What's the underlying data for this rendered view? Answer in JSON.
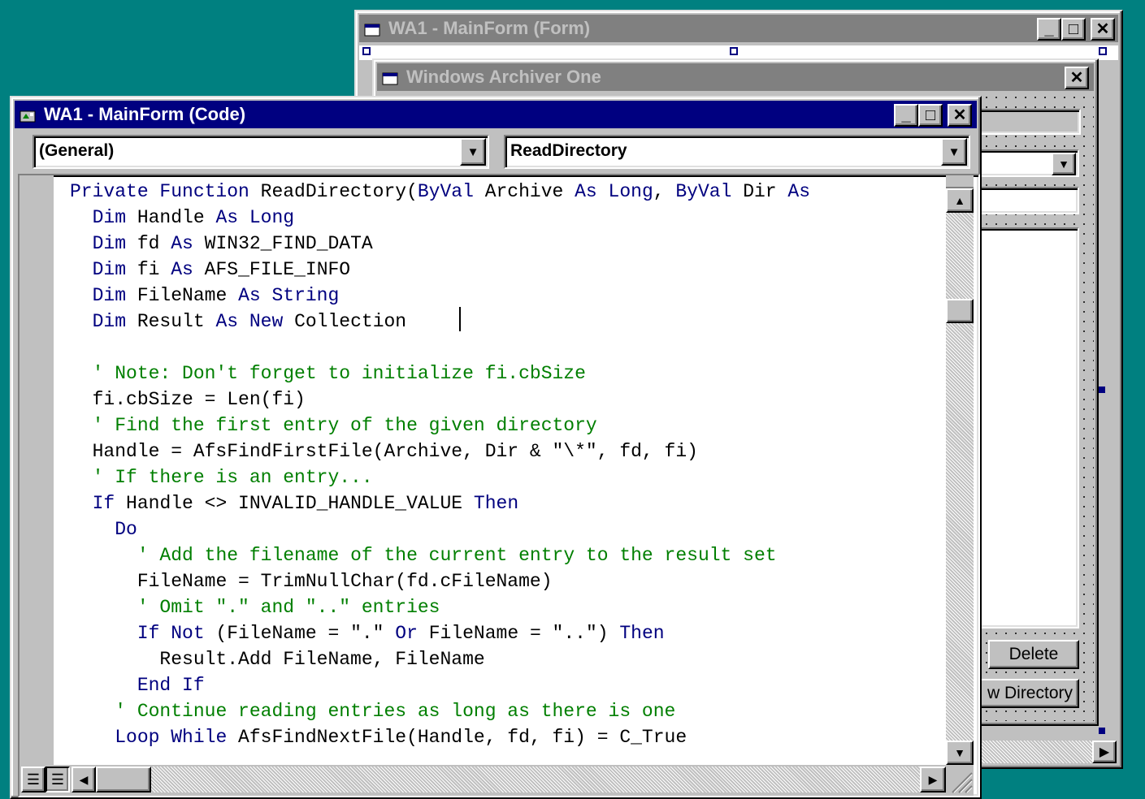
{
  "form_window": {
    "title": "WA1 - MainForm (Form)",
    "min": "_",
    "max": "□",
    "close": "✕"
  },
  "archiver_window": {
    "title": "Windows Archiver One",
    "close": "✕",
    "delete_label": "Delete",
    "new_dir_label": "w Directory"
  },
  "code_window": {
    "title": "WA1 - MainForm (Code)",
    "min": "_",
    "max": "□",
    "close": "✕",
    "object_combo": "(General)",
    "proc_combo": "ReadDirectory"
  },
  "code_lines": [
    {
      "indent": "",
      "parts": [
        [
          "kw",
          "Private Function "
        ],
        [
          "tx",
          "ReadDirectory("
        ],
        [
          "kw",
          "ByVal "
        ],
        [
          "tx",
          "Archive "
        ],
        [
          "kw",
          "As Long"
        ],
        [
          "tx",
          ", "
        ],
        [
          "kw",
          "ByVal "
        ],
        [
          "tx",
          "Dir "
        ],
        [
          "kw",
          "As "
        ]
      ]
    },
    {
      "indent": "  ",
      "parts": [
        [
          "kw",
          "Dim "
        ],
        [
          "tx",
          "Handle "
        ],
        [
          "kw",
          "As Long"
        ]
      ]
    },
    {
      "indent": "  ",
      "parts": [
        [
          "kw",
          "Dim "
        ],
        [
          "tx",
          "fd "
        ],
        [
          "kw",
          "As "
        ],
        [
          "tx",
          "WIN32_FIND_DATA"
        ]
      ]
    },
    {
      "indent": "  ",
      "parts": [
        [
          "kw",
          "Dim "
        ],
        [
          "tx",
          "fi "
        ],
        [
          "kw",
          "As "
        ],
        [
          "tx",
          "AFS_FILE_INFO"
        ]
      ]
    },
    {
      "indent": "  ",
      "parts": [
        [
          "kw",
          "Dim "
        ],
        [
          "tx",
          "FileName "
        ],
        [
          "kw",
          "As String"
        ]
      ]
    },
    {
      "indent": "  ",
      "parts": [
        [
          "kw",
          "Dim "
        ],
        [
          "tx",
          "Result "
        ],
        [
          "kw",
          "As New "
        ],
        [
          "tx",
          "Collection"
        ]
      ]
    },
    {
      "indent": "",
      "parts": []
    },
    {
      "indent": "  ",
      "parts": [
        [
          "cm",
          "' Note: Don't forget to initialize fi.cbSize"
        ]
      ]
    },
    {
      "indent": "  ",
      "parts": [
        [
          "tx",
          "fi.cbSize = Len(fi)"
        ]
      ]
    },
    {
      "indent": "  ",
      "parts": [
        [
          "cm",
          "' Find the first entry of the given directory"
        ]
      ]
    },
    {
      "indent": "  ",
      "parts": [
        [
          "tx",
          "Handle = AfsFindFirstFile(Archive, Dir & \"\\*\", fd, fi)"
        ]
      ]
    },
    {
      "indent": "  ",
      "parts": [
        [
          "cm",
          "' If there is an entry..."
        ]
      ]
    },
    {
      "indent": "  ",
      "parts": [
        [
          "kw",
          "If "
        ],
        [
          "tx",
          "Handle <> INVALID_HANDLE_VALUE "
        ],
        [
          "kw",
          "Then"
        ]
      ]
    },
    {
      "indent": "    ",
      "parts": [
        [
          "kw",
          "Do"
        ]
      ]
    },
    {
      "indent": "      ",
      "parts": [
        [
          "cm",
          "' Add the filename of the current entry to the result set"
        ]
      ]
    },
    {
      "indent": "      ",
      "parts": [
        [
          "tx",
          "FileName = TrimNullChar(fd.cFileName)"
        ]
      ]
    },
    {
      "indent": "      ",
      "parts": [
        [
          "cm",
          "' Omit \".\" and \"..\" entries"
        ]
      ]
    },
    {
      "indent": "      ",
      "parts": [
        [
          "kw",
          "If Not "
        ],
        [
          "tx",
          "(FileName = \".\" "
        ],
        [
          "kw",
          "Or "
        ],
        [
          "tx",
          "FileName = \"..\") "
        ],
        [
          "kw",
          "Then"
        ]
      ]
    },
    {
      "indent": "        ",
      "parts": [
        [
          "tx",
          "Result.Add FileName, FileName"
        ]
      ]
    },
    {
      "indent": "      ",
      "parts": [
        [
          "kw",
          "End If"
        ]
      ]
    },
    {
      "indent": "    ",
      "parts": [
        [
          "cm",
          "' Continue reading entries as long as there is one"
        ]
      ]
    },
    {
      "indent": "    ",
      "parts": [
        [
          "kw",
          "Loop While "
        ],
        [
          "tx",
          "AfsFindNextFile(Handle, fd, fi) = C_True"
        ]
      ]
    }
  ]
}
